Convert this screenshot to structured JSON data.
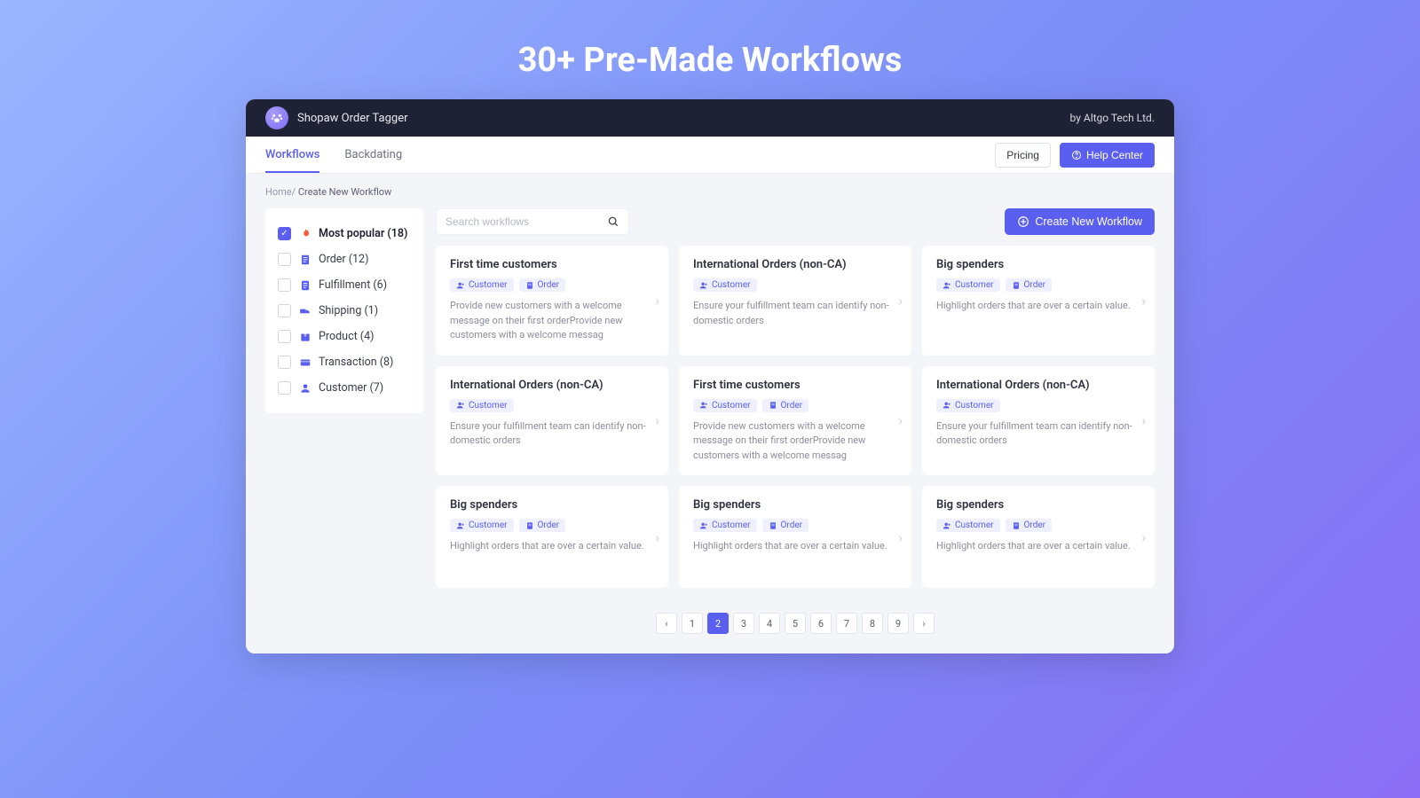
{
  "hero_title": "30+ Pre-Made Workflows",
  "brand": {
    "name": "Shopaw Order Tagger",
    "vendor_prefix": "by ",
    "vendor": "Altgo Tech Ltd."
  },
  "tabs": {
    "workflows": "Workflows",
    "backdating": "Backdating"
  },
  "nav": {
    "pricing": "Pricing",
    "help_center": "Help Center"
  },
  "breadcrumb": {
    "home": "Home",
    "sep": "/",
    "current": "Create New Workflow"
  },
  "search": {
    "placeholder": "Search workflows"
  },
  "create_button": "Create New Workflow",
  "filters": [
    {
      "icon": "flame",
      "color": "#f85c3a",
      "label": "Most popular",
      "count": 18,
      "checked": true
    },
    {
      "icon": "clipboard",
      "color": "#5b5fef",
      "label": "Order",
      "count": 12,
      "checked": false
    },
    {
      "icon": "clipboard",
      "color": "#5b5fef",
      "label": "Fulfillment",
      "count": 6,
      "checked": false
    },
    {
      "icon": "truck",
      "color": "#5b5fef",
      "label": "Shipping",
      "count": 1,
      "checked": false
    },
    {
      "icon": "box",
      "color": "#5b5fef",
      "label": "Product",
      "count": 4,
      "checked": false
    },
    {
      "icon": "card",
      "color": "#5b5fef",
      "label": "Transaction",
      "count": 8,
      "checked": false
    },
    {
      "icon": "user",
      "color": "#5b5fef",
      "label": "Customer",
      "count": 7,
      "checked": false
    }
  ],
  "tag_labels": {
    "customer": "Customer",
    "order": "Order"
  },
  "cards": [
    {
      "title": "First time customers",
      "tags": [
        "customer",
        "order"
      ],
      "desc": "Provide new customers with a welcome message on their first orderProvide new customers with a welcome messag"
    },
    {
      "title": "International Orders (non-CA)",
      "tags": [
        "customer"
      ],
      "desc": "Ensure your fulfillment team can identify non-domestic orders"
    },
    {
      "title": "Big spenders",
      "tags": [
        "customer",
        "order"
      ],
      "desc": "Highlight orders that are over a certain value."
    },
    {
      "title": "International Orders (non-CA)",
      "tags": [
        "customer"
      ],
      "desc": "Ensure your fulfillment team can identify non-domestic orders"
    },
    {
      "title": "First time customers",
      "tags": [
        "customer",
        "order"
      ],
      "desc": "Provide new customers with a welcome message on their first orderProvide new customers with a welcome messag"
    },
    {
      "title": "International Orders (non-CA)",
      "tags": [
        "customer"
      ],
      "desc": "Ensure your fulfillment team can identify non-domestic orders"
    },
    {
      "title": "Big spenders",
      "tags": [
        "customer",
        "order"
      ],
      "desc": "Highlight orders that are over a certain value."
    },
    {
      "title": "Big spenders",
      "tags": [
        "customer",
        "order"
      ],
      "desc": "Highlight orders that are over a certain value."
    },
    {
      "title": "Big spenders",
      "tags": [
        "customer",
        "order"
      ],
      "desc": "Highlight orders that are over a certain value."
    }
  ],
  "pagination": {
    "pages": [
      1,
      2,
      3,
      4,
      5,
      6,
      7,
      8,
      9
    ],
    "current": 2
  }
}
